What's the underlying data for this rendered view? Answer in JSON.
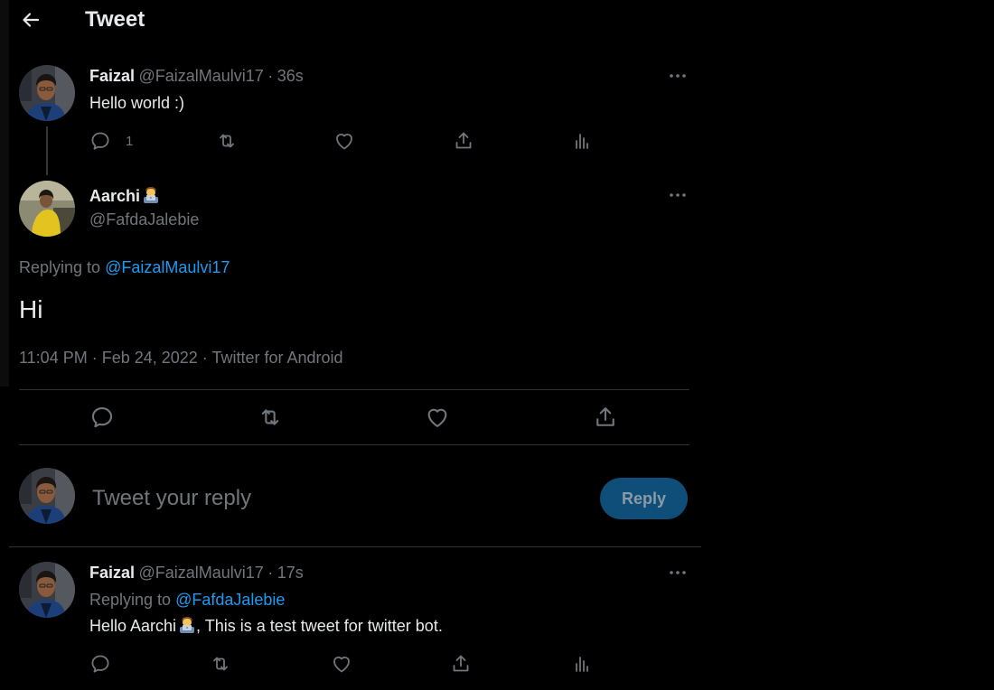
{
  "header": {
    "title": "Tweet"
  },
  "parent_tweet": {
    "name": "Faizal",
    "handle": "@FaizalMaulvi17",
    "separator": "·",
    "time": "36s",
    "text": "Hello world :)",
    "reply_count": "1"
  },
  "main_tweet": {
    "name": "Aarchi",
    "handle": "@FafdaJalebie",
    "replying_prefix": "Replying to",
    "replying_handle": "@FaizalMaulvi17",
    "text": "Hi",
    "meta": "11:04 PM · Feb 24, 2022 · Twitter for Android"
  },
  "composer": {
    "placeholder": "Tweet your reply",
    "button_label": "Reply"
  },
  "reply_tweet": {
    "name": "Faizal",
    "handle": "@FaizalMaulvi17",
    "separator": "·",
    "time": "17s",
    "replying_prefix": "Replying to",
    "replying_handle": "@FafdaJalebie",
    "text_before": "Hello Aarchi",
    "text_after": ", This is a test tweet for twitter bot."
  },
  "icons": {
    "back": "arrow-left-icon",
    "more": "more-horizontal-icon",
    "reply": "speech-bubble-icon",
    "retweet": "retweet-icon",
    "like": "heart-icon",
    "share": "share-icon",
    "analytics": "bar-chart-icon",
    "emoji": "woman-technologist-emoji"
  },
  "colors": {
    "background": "#000000",
    "text": "#e7e9ea",
    "muted": "#71767b",
    "link": "#1d9bf0",
    "divider": "#2f3336",
    "reply_button": "#0f4e78"
  }
}
